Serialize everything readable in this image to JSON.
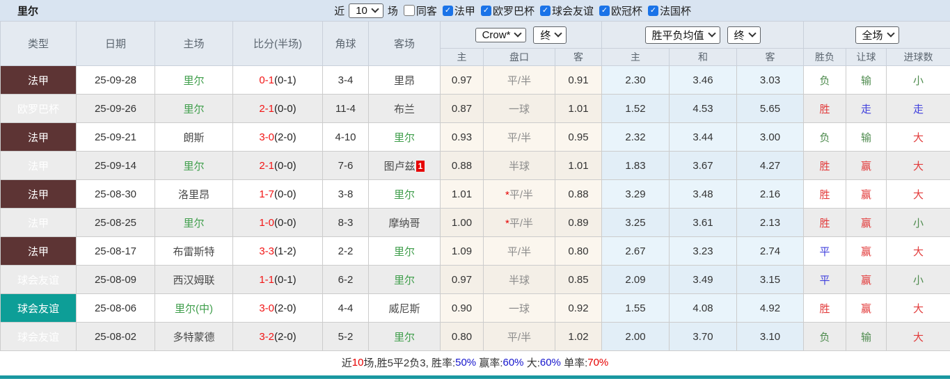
{
  "topbar": {
    "team": "里尔",
    "recent_label": "近",
    "recent_count": "10",
    "matches_label": "场",
    "same_away": {
      "label": "同客",
      "checked": false
    },
    "leagues": [
      {
        "label": "法甲",
        "checked": true
      },
      {
        "label": "欧罗巴杯",
        "checked": true
      },
      {
        "label": "球会友谊",
        "checked": true
      },
      {
        "label": "欧冠杯",
        "checked": true
      },
      {
        "label": "法国杯",
        "checked": true
      }
    ]
  },
  "icons": {
    "check": "✓",
    "chevron_down": "∨"
  },
  "table": {
    "columns": {
      "type": "类型",
      "date": "日期",
      "home": "主场",
      "score": "比分(半场)",
      "corner": "角球",
      "away": "客场"
    },
    "selects": {
      "odds_company": "Crow*",
      "odds_stage": "终",
      "avg_metric": "胜平负均值",
      "avg_stage": "终",
      "scope": "全场"
    },
    "sub": [
      "主",
      "盘口",
      "客",
      "主",
      "和",
      "客",
      "胜负",
      "让球",
      "进球数"
    ],
    "rows": [
      {
        "type": "法甲",
        "date": "25-09-28",
        "home": "里尔",
        "home_hl": true,
        "score": "0-1",
        "half": "(0-1)",
        "corner": "3-4",
        "away": "里昂",
        "away_hl": false,
        "away_badge": "",
        "crow_home": "0.97",
        "hc_star": "",
        "handicap": "平/半",
        "crow_away": "0.91",
        "avg_home": "2.30",
        "avg_draw": "3.46",
        "avg_away": "3.03",
        "result_wdl": "负",
        "result_handicap": "输",
        "result_goals": "小"
      },
      {
        "type": "欧罗巴杯",
        "date": "25-09-26",
        "home": "里尔",
        "home_hl": true,
        "score": "2-1",
        "half": "(0-0)",
        "corner": "11-4",
        "away": "布兰",
        "away_hl": false,
        "away_badge": "",
        "crow_home": "0.87",
        "hc_star": "",
        "handicap": "一球",
        "crow_away": "1.01",
        "avg_home": "1.52",
        "avg_draw": "4.53",
        "avg_away": "5.65",
        "result_wdl": "胜",
        "result_handicap": "走",
        "result_goals": "走"
      },
      {
        "type": "法甲",
        "date": "25-09-21",
        "home": "朗斯",
        "home_hl": false,
        "score": "3-0",
        "half": "(2-0)",
        "corner": "4-10",
        "away": "里尔",
        "away_hl": true,
        "away_badge": "",
        "crow_home": "0.93",
        "hc_star": "",
        "handicap": "平/半",
        "crow_away": "0.95",
        "avg_home": "2.32",
        "avg_draw": "3.44",
        "avg_away": "3.00",
        "result_wdl": "负",
        "result_handicap": "输",
        "result_goals": "大"
      },
      {
        "type": "法甲",
        "date": "25-09-14",
        "home": "里尔",
        "home_hl": true,
        "score": "2-1",
        "half": "(0-0)",
        "corner": "7-6",
        "away": "图卢兹",
        "away_hl": false,
        "away_badge": "1",
        "crow_home": "0.88",
        "hc_star": "",
        "handicap": "半球",
        "crow_away": "1.01",
        "avg_home": "1.83",
        "avg_draw": "3.67",
        "avg_away": "4.27",
        "result_wdl": "胜",
        "result_handicap": "赢",
        "result_goals": "大"
      },
      {
        "type": "法甲",
        "date": "25-08-30",
        "home": "洛里昂",
        "home_hl": false,
        "score": "1-7",
        "half": "(0-0)",
        "corner": "3-8",
        "away": "里尔",
        "away_hl": true,
        "away_badge": "",
        "crow_home": "1.01",
        "hc_star": "*",
        "handicap": "平/半",
        "crow_away": "0.88",
        "avg_home": "3.29",
        "avg_draw": "3.48",
        "avg_away": "2.16",
        "result_wdl": "胜",
        "result_handicap": "赢",
        "result_goals": "大"
      },
      {
        "type": "法甲",
        "date": "25-08-25",
        "home": "里尔",
        "home_hl": true,
        "score": "1-0",
        "half": "(0-0)",
        "corner": "8-3",
        "away": "摩纳哥",
        "away_hl": false,
        "away_badge": "",
        "crow_home": "1.00",
        "hc_star": "*",
        "handicap": "平/半",
        "crow_away": "0.89",
        "avg_home": "3.25",
        "avg_draw": "3.61",
        "avg_away": "2.13",
        "result_wdl": "胜",
        "result_handicap": "赢",
        "result_goals": "小"
      },
      {
        "type": "法甲",
        "date": "25-08-17",
        "home": "布雷斯特",
        "home_hl": false,
        "score": "3-3",
        "half": "(1-2)",
        "corner": "2-2",
        "away": "里尔",
        "away_hl": true,
        "away_badge": "",
        "crow_home": "1.09",
        "hc_star": "",
        "handicap": "平/半",
        "crow_away": "0.80",
        "avg_home": "2.67",
        "avg_draw": "3.23",
        "avg_away": "2.74",
        "result_wdl": "平",
        "result_handicap": "赢",
        "result_goals": "大"
      },
      {
        "type": "球会友谊",
        "date": "25-08-09",
        "home": "西汉姆联",
        "home_hl": false,
        "score": "1-1",
        "half": "(0-1)",
        "corner": "6-2",
        "away": "里尔",
        "away_hl": true,
        "away_badge": "",
        "crow_home": "0.97",
        "hc_star": "",
        "handicap": "半球",
        "crow_away": "0.85",
        "avg_home": "2.09",
        "avg_draw": "3.49",
        "avg_away": "3.15",
        "result_wdl": "平",
        "result_handicap": "赢",
        "result_goals": "小"
      },
      {
        "type": "球会友谊",
        "date": "25-08-06",
        "home": "里尔(中)",
        "home_hl": true,
        "score": "3-0",
        "half": "(2-0)",
        "corner": "4-4",
        "away": "威尼斯",
        "away_hl": false,
        "away_badge": "",
        "crow_home": "0.90",
        "hc_star": "",
        "handicap": "一球",
        "crow_away": "0.92",
        "avg_home": "1.55",
        "avg_draw": "4.08",
        "avg_away": "4.92",
        "result_wdl": "胜",
        "result_handicap": "赢",
        "result_goals": "大"
      },
      {
        "type": "球会友谊",
        "date": "25-08-02",
        "home": "多特蒙德",
        "home_hl": false,
        "score": "3-2",
        "half": "(2-0)",
        "corner": "5-2",
        "away": "里尔",
        "away_hl": true,
        "away_badge": "",
        "crow_home": "0.80",
        "hc_star": "",
        "handicap": "平/半",
        "crow_away": "1.02",
        "avg_home": "2.00",
        "avg_draw": "3.70",
        "avg_away": "3.10",
        "result_wdl": "负",
        "result_handicap": "输",
        "result_goals": "大"
      }
    ]
  },
  "summary": {
    "parts": [
      {
        "t": "近",
        "c": "dark"
      },
      {
        "t": "10",
        "c": "red"
      },
      {
        "t": "场,胜5平2负3, 胜率:",
        "c": "dark"
      },
      {
        "t": "50%",
        "c": "blue"
      },
      {
        "t": " 赢率:",
        "c": "dark"
      },
      {
        "t": "60%",
        "c": "blue"
      },
      {
        "t": " 大:",
        "c": "dark"
      },
      {
        "t": "60%",
        "c": "blue"
      },
      {
        "t": " 单率:",
        "c": "dark"
      },
      {
        "t": "70%",
        "c": "red"
      }
    ]
  },
  "colors": {
    "ligue1_bg": "#5d3434",
    "europa_bg": "#7a12d4",
    "friendly_bg": "#0d9e97",
    "win_red": "#e23b3b",
    "lose_green": "#4e8b4e",
    "draw_blue": "#4040dd",
    "team_green": "#3f9e4b",
    "score_red": "#f21515",
    "checkbox_blue": "#1a73e8",
    "topbar_bg": "#d9e4f1",
    "divider_teal": "#1a98a0"
  }
}
